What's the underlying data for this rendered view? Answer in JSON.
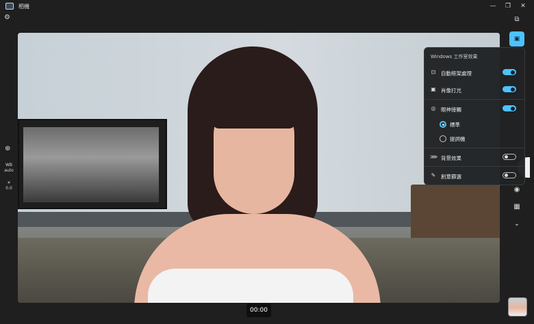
{
  "app": {
    "title": "相機"
  },
  "window": {
    "minimize_icon": "minimize-icon",
    "restore_icon": "restore-icon",
    "close_icon": "close-icon"
  },
  "left_rail": {
    "settings_icon": "gear-icon",
    "zoom_icon": "zoom-in-icon",
    "wb_label": "WB",
    "wb_value": "auto",
    "exposure_value": "0.0"
  },
  "panel": {
    "title": "Windows 工作室效果",
    "items": [
      {
        "label": "自動框架處理",
        "icon": "auto-framing-icon",
        "enabled": true
      },
      {
        "label": "肖像打光",
        "icon": "portrait-light-icon",
        "enabled": true
      },
      {
        "label": "眼神接觸",
        "icon": "eye-contact-icon",
        "enabled": true
      },
      {
        "label": "背景效果",
        "icon": "background-effect-icon",
        "enabled": false
      },
      {
        "label": "創意篩選",
        "icon": "creative-filter-icon",
        "enabled": false
      }
    ],
    "eye_contact_options": [
      {
        "label": "標準",
        "selected": true
      },
      {
        "label": "提詞機",
        "selected": false
      }
    ]
  },
  "right_rail": {
    "switch_camera_icon": "switch-camera-icon",
    "effects_icon": "studio-effects-icon",
    "photo_mode_icon": "camera-icon",
    "qr_mode_icon": "qr-code-icon",
    "more_icon": "chevron-down-icon"
  },
  "recording": {
    "timer": "00:00"
  },
  "colors": {
    "accent": "#4cc2ff",
    "background": "#1f1f1f"
  }
}
